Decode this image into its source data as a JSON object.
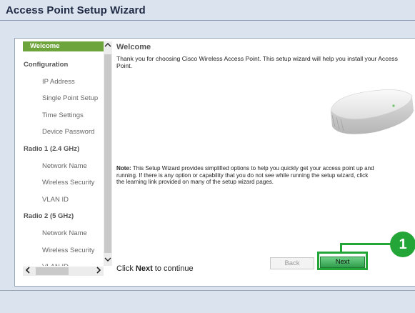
{
  "window": {
    "title": "Access Point Setup Wizard"
  },
  "sidebar": {
    "items": [
      {
        "label": "Welcome",
        "kind": "active"
      },
      {
        "label": "Configuration",
        "kind": "section"
      },
      {
        "label": "IP Address",
        "kind": "sub"
      },
      {
        "label": "Single Point Setup",
        "kind": "sub"
      },
      {
        "label": "Time Settings",
        "kind": "sub"
      },
      {
        "label": "Device Password",
        "kind": "sub"
      },
      {
        "label": "Radio 1 (2.4 GHz)",
        "kind": "section"
      },
      {
        "label": "Network Name",
        "kind": "sub"
      },
      {
        "label": "Wireless Security",
        "kind": "sub"
      },
      {
        "label": "VLAN ID",
        "kind": "sub"
      },
      {
        "label": "Radio 2 (5 GHz)",
        "kind": "section"
      },
      {
        "label": "Network Name",
        "kind": "sub"
      },
      {
        "label": "Wireless Security",
        "kind": "sub"
      },
      {
        "label": "VLAN ID",
        "kind": "sub"
      }
    ],
    "scroll_up": "^",
    "scroll_down": "v",
    "scroll_left": "<",
    "scroll_right": ">"
  },
  "main": {
    "heading": "Welcome",
    "intro": "Thank you for choosing Cisco Wireless Access Point. This setup wizard will help you install your Access Point.",
    "note_label": "Note:",
    "note_line1": " This Setup Wizard provides simplified options to help you quickly get your access point up and",
    "note_line2": "running. If there is any option or capability that you do not see while running the setup wizard, click",
    "note_line3": "the learning link provided on many of the setup wizard pages.",
    "continue_prefix": "Click ",
    "continue_bold": "Next",
    "continue_suffix": " to continue"
  },
  "buttons": {
    "back": "Back",
    "next": "Next"
  },
  "callout": {
    "number": "1"
  },
  "colors": {
    "accent_green": "#6ea43c",
    "callout_green": "#23a637",
    "background": "#dbe3ee"
  }
}
